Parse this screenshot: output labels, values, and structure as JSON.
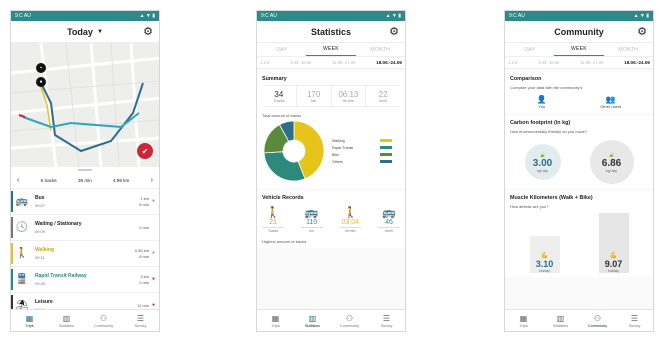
{
  "status_time": "9:C AU",
  "status_icons": "▲ ▼ ▮",
  "phone1": {
    "title": "Today",
    "fab_icon": "checkmark-icon",
    "summary": {
      "tracks": "6 tracks",
      "minutes": "39 min",
      "km": "4.99 km"
    },
    "trips": [
      {
        "name": "Bus",
        "time": "09:07",
        "dist": "1 km",
        "dur": "8 min",
        "color": "#2c6f8a",
        "icon": "🚌"
      },
      {
        "name": "Waiting / Stationary",
        "time": "09:09",
        "dist": "",
        "dur": "2 min",
        "color": "#777777",
        "icon": "🕓"
      },
      {
        "name": "Walking",
        "time": "09:11",
        "dist": "0.56 km",
        "dur": "8 min",
        "color": "#e6c41a",
        "icon": "🚶"
      },
      {
        "name": "Rapid Transit Railway",
        "time": "09:45",
        "dist": "3 km",
        "dur": "2 min",
        "color": "#2c8a7a",
        "icon": "🚆"
      },
      {
        "name": "Leisure",
        "time": "09:51",
        "dist": "",
        "dur": "12 min",
        "color": "#333333",
        "icon": "⛱"
      }
    ]
  },
  "nav": {
    "trips": "Trips",
    "statistics": "Statistics",
    "community": "Community",
    "survey": "Survey"
  },
  "tabs": {
    "day": "DAY",
    "week": "WEEK",
    "month": "MONTH"
  },
  "phone2": {
    "title": "Statistics",
    "weeks": [
      "1.2.6",
      "4.03.-10.06",
      "11.06.-17.06",
      "18.06.-24.06"
    ],
    "summary_title": "Summary",
    "stats": [
      {
        "value": "34",
        "label": "Tracks"
      },
      {
        "value": "170",
        "label": "km"
      },
      {
        "value": "06:13",
        "label": "hh:mm"
      },
      {
        "value": "22",
        "label": "km/h"
      }
    ],
    "donut_title": "Total amount of tracks",
    "legend": [
      {
        "label": "Walking",
        "color": "#e6c41a"
      },
      {
        "label": "Rapid Transit",
        "color": "#2c8a7a"
      },
      {
        "label": "Bike",
        "color": "#5a8a3a"
      },
      {
        "label": "Others",
        "color": "#2c6f8a"
      }
    ],
    "chart_data": {
      "type": "pie",
      "values": [
        44,
        30,
        18,
        8
      ],
      "colors": [
        "#e6c41a",
        "#2c8a7a",
        "#5a8a3a",
        "#2c6f8a"
      ]
    },
    "vehicle_title": "Vehicle Records",
    "vehicles": [
      {
        "value": "21",
        "label": "Tracks",
        "color": "#e6c41a",
        "icon": "🚶"
      },
      {
        "value": "110",
        "label": "km",
        "color": "#2c8a8a",
        "icon": "🚌"
      },
      {
        "value": "03:04",
        "label": "hh:mm",
        "color": "#e6c41a",
        "icon": "🚶"
      },
      {
        "value": "46",
        "label": "km/h",
        "color": "#2c8a8a",
        "icon": "🚌"
      }
    ],
    "highest_title": "Highest amount of tracks"
  },
  "phone3": {
    "title": "Community",
    "weeks": [
      "1.2.6",
      "4.03.-10.06",
      "11.06.-17.06",
      "18.06.-24.06"
    ],
    "comparison_title": "Comparison",
    "comparison_sub": "Compare your data with the community's",
    "you": "You",
    "other": "Other users",
    "carbon_title": "Carbon footprint (in kg)",
    "carbon_sub": "How environmentally friendly do you move?",
    "carbon_you": "3.00",
    "carbon_other": "6.86",
    "carbon_unit": "kg/ day",
    "muscle_title": "Muscle Kilometers (Walk + Bike)",
    "muscle_sub": "How athletic are you?",
    "muscle_you": "3.10",
    "muscle_other": "9.07",
    "muscle_unit": "km/day"
  }
}
